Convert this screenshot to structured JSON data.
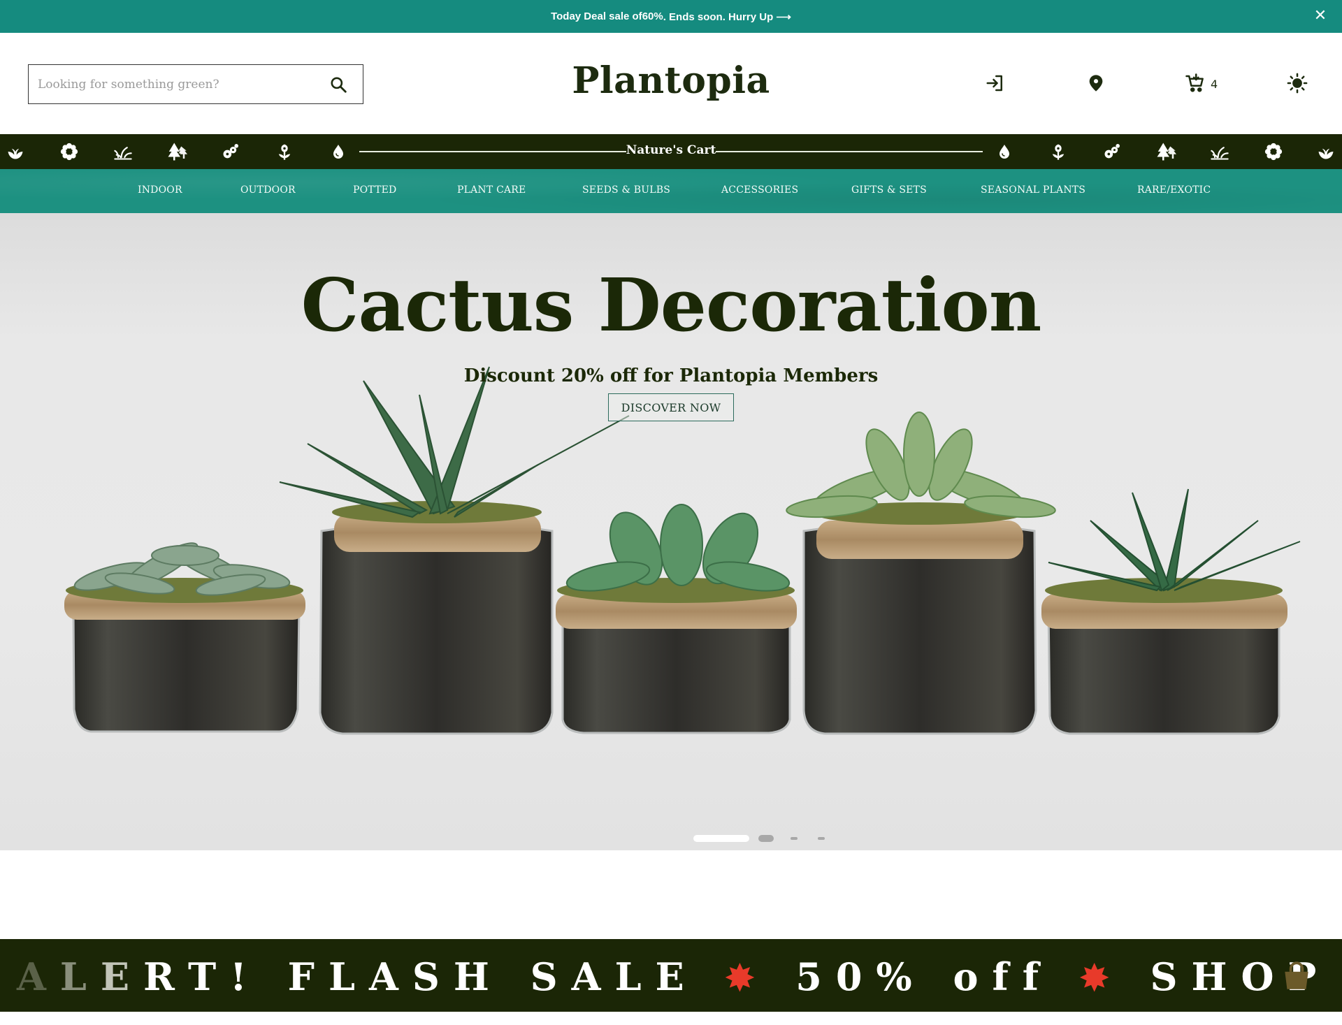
{
  "promo": {
    "text_before": "Today Deal sale of ",
    "percent": "60%",
    "text_after": ". Ends soon. Hurry Up ⟶",
    "close_glyph": "✕"
  },
  "header": {
    "search_placeholder": "Looking for something green?",
    "brand": "Plantopia",
    "cart_count": "4",
    "icons": [
      "login-icon",
      "location-pin-icon",
      "cart-icon",
      "sun-icon"
    ]
  },
  "strip": {
    "title": "Nature's Cart",
    "icons_left": [
      "sprout-icon",
      "flower-icon",
      "grass-icon",
      "trees-icon",
      "seeds-icon",
      "tulip-icon",
      "droplet-icon"
    ],
    "icons_right": [
      "droplet-icon",
      "tulip-icon",
      "seeds-icon",
      "trees-icon",
      "grass-icon",
      "flower-icon",
      "sprout-icon"
    ]
  },
  "categories": [
    "INDOOR",
    "OUTDOOR",
    "POTTED",
    "PLANT CARE",
    "SEEDS & BULBS",
    "ACCESSORIES",
    "GIFTS & SETS",
    "SEASONAL PLANTS",
    "RARE/EXOTIC"
  ],
  "hero": {
    "title": "Cactus Decoration",
    "subtitle": "Discount 20% off for Plantopia Members",
    "button": "DISCOVER NOW",
    "slides_total": 4,
    "active_slide": 1
  },
  "flash": {
    "part1": "A",
    "part2": "L",
    "part3": "E",
    "part4": "RT! FLASH SALE",
    "burst": "✸",
    "part5": "50% off",
    "part6": "SHOP NOW!"
  },
  "colors": {
    "teal": "#158b7f",
    "dark_green": "#1b2606",
    "brand_text": "#1d2b0f"
  }
}
